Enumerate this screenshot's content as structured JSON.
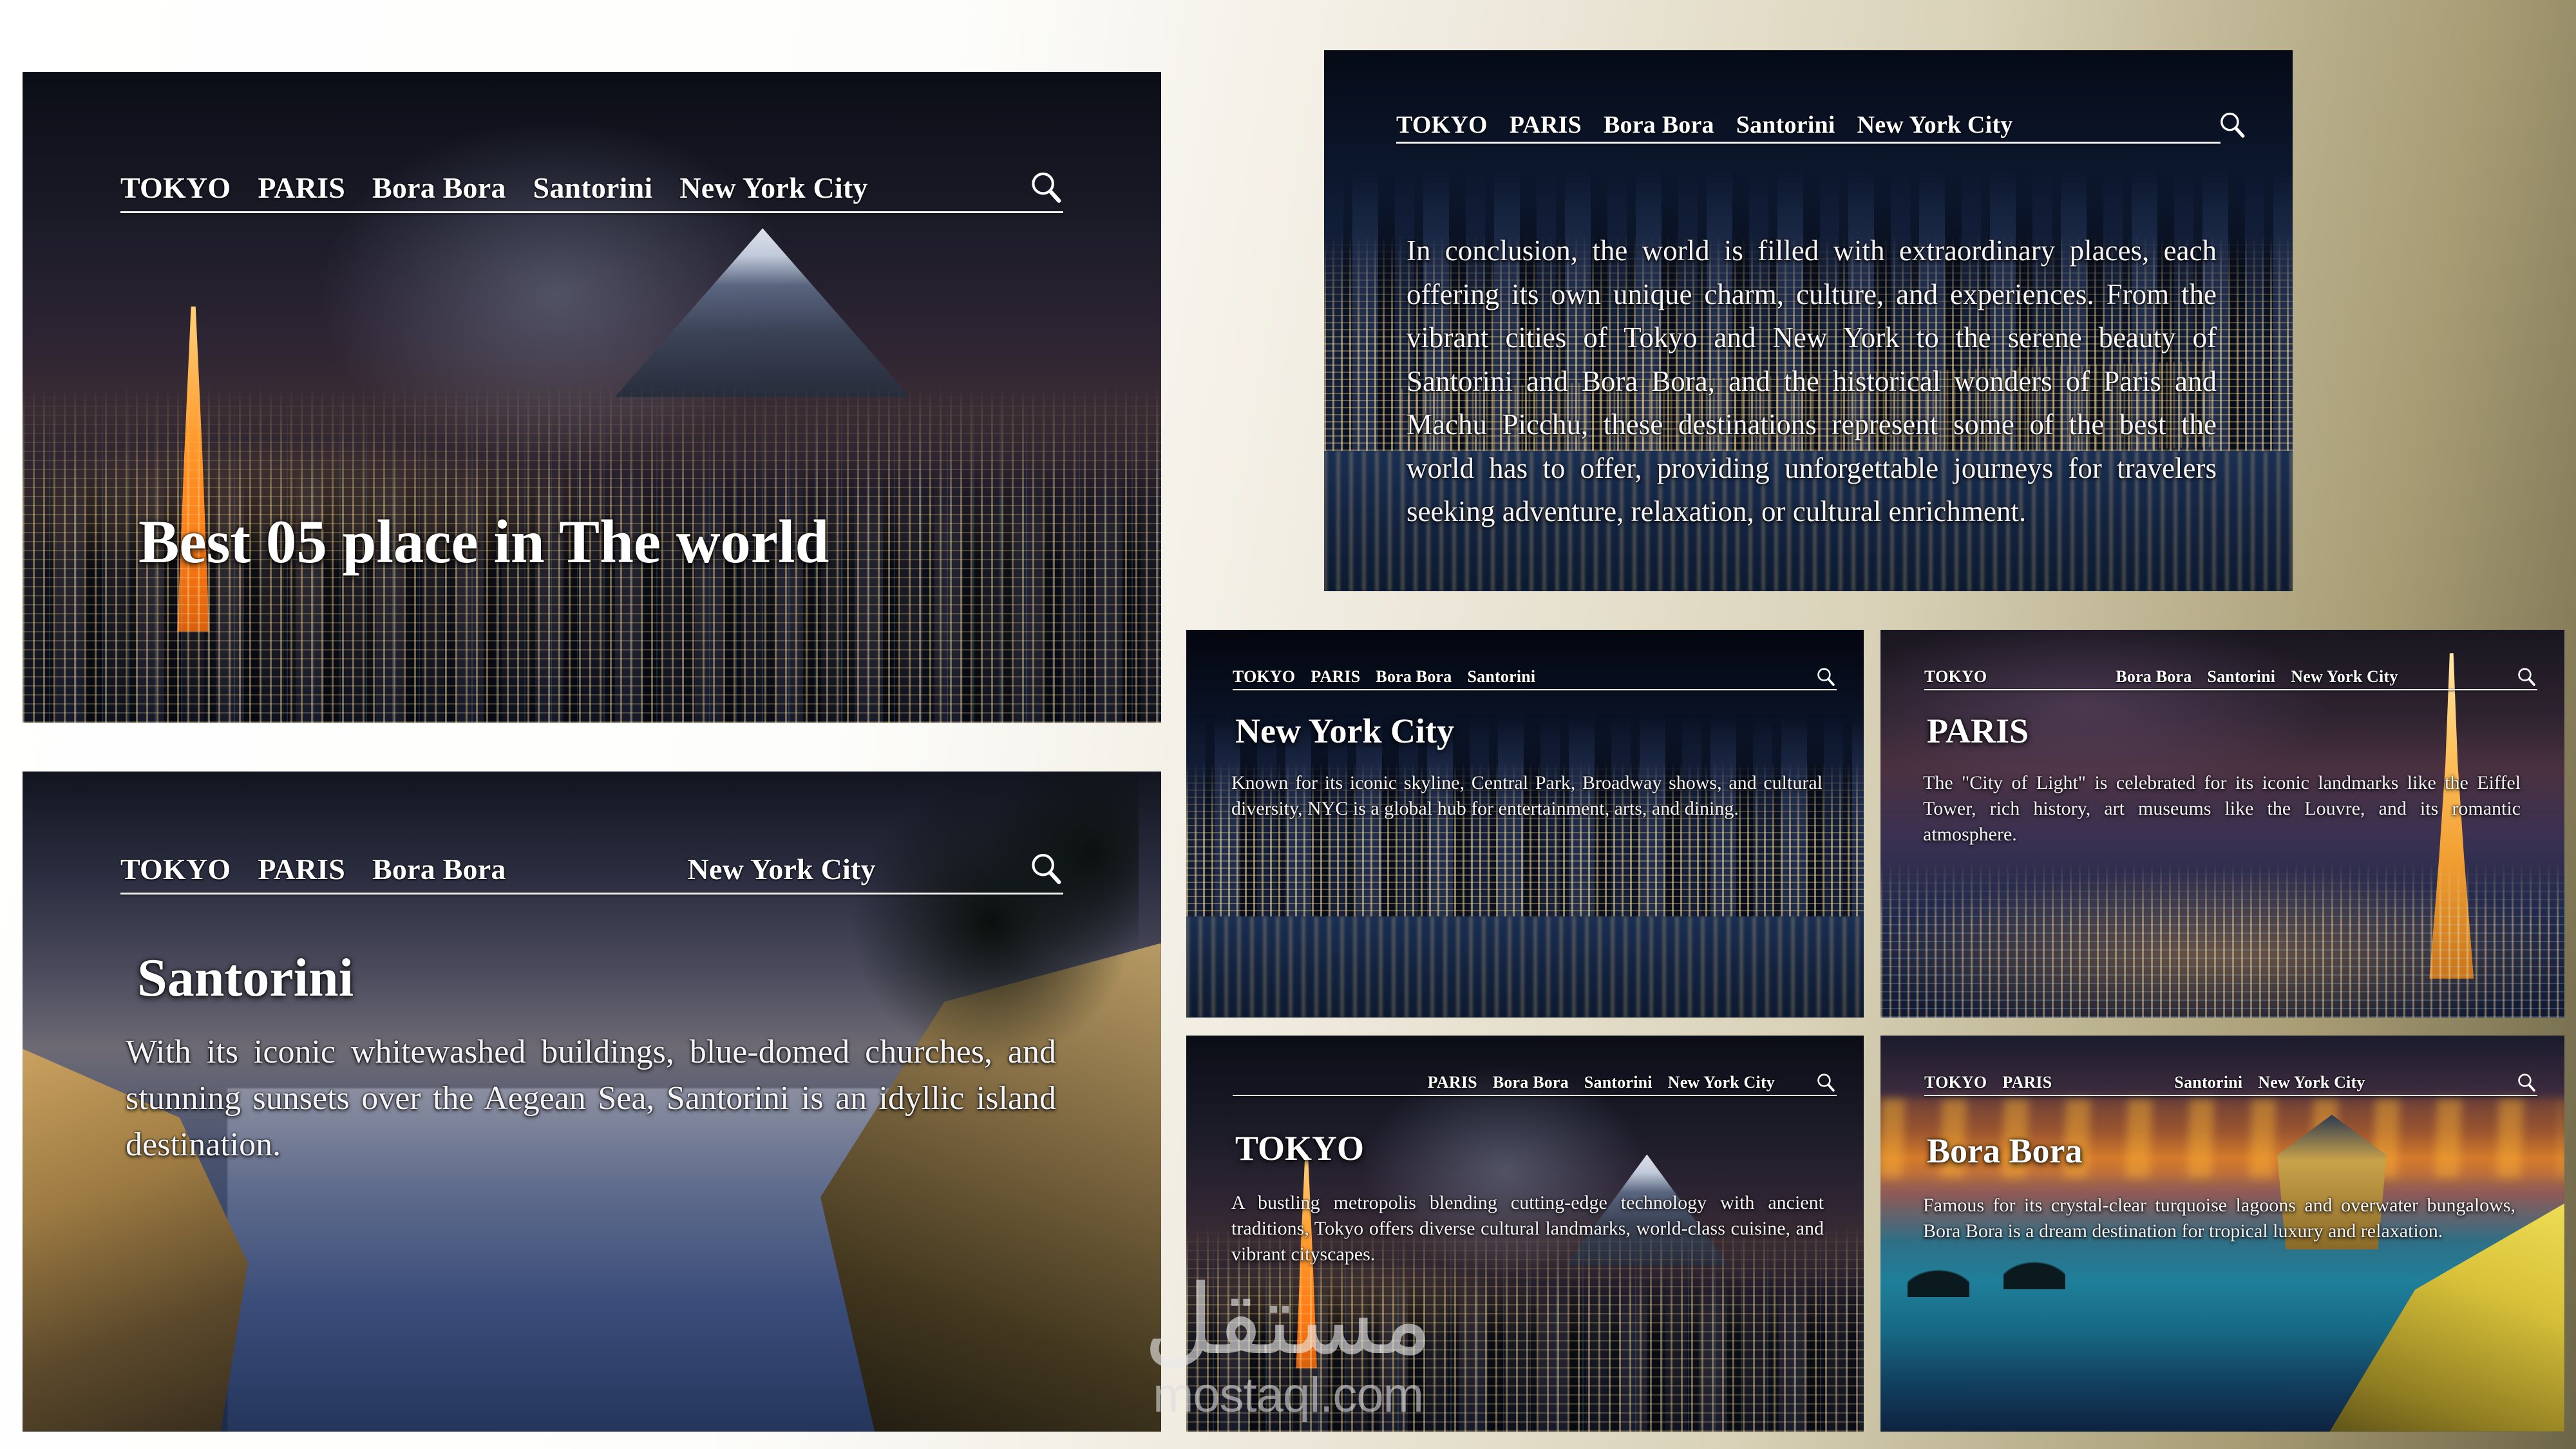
{
  "site": {
    "nav_items": [
      "TOKYO",
      "PARIS",
      "Bora Bora",
      "Santorini",
      "New York City"
    ],
    "search_icon": "search-icon"
  },
  "hero": {
    "title": "Best 05 place in The world",
    "nav": [
      "TOKYO",
      "PARIS",
      "Bora Bora",
      "Santorini",
      "New York City"
    ]
  },
  "conclusion": {
    "nav": [
      "TOKYO",
      "PARIS",
      "Bora Bora",
      "Santorini",
      "New York City"
    ],
    "text": "In conclusion, the world is filled with extraordinary places, each offering its own unique charm, culture, and experiences. From the vibrant cities of Tokyo and New York to the serene beauty of Santorini and Bora Bora, and the historical wonders of Paris and Machu Picchu, these destinations represent some of the best the world has to offer, providing unforgettable journeys for travelers seeking adventure, relaxation, or cultural enrichment."
  },
  "santorini": {
    "title": "Santorini",
    "nav": [
      "TOKYO",
      "PARIS",
      "Bora Bora",
      "",
      "New York City"
    ],
    "text": "With its iconic whitewashed buildings, blue-domed churches, and stunning sunsets over the Aegean Sea, Santorini is an idyllic island destination."
  },
  "cards": {
    "nyc": {
      "title": "New York City",
      "nav": [
        "TOKYO",
        "PARIS",
        "Bora Bora",
        "Santorini"
      ],
      "text": "Known for its iconic skyline, Central Park, Broadway shows, and cultural diversity, NYC is a global hub for entertainment, arts, and dining."
    },
    "paris": {
      "title": "PARIS",
      "nav": [
        "TOKYO",
        "",
        "Bora Bora",
        "Santorini",
        "New York City"
      ],
      "text": "The \"City of Light\" is celebrated for its iconic landmarks like the Eiffel Tower, rich history, art museums like the Louvre, and its romantic atmosphere."
    },
    "tokyo": {
      "title": "TOKYO",
      "nav": [
        "PARIS",
        "Bora Bora",
        "Santorini",
        "New York City"
      ],
      "text": "A bustling metropolis blending cutting-edge technology with ancient traditions, Tokyo offers diverse cultural landmarks, world-class cuisine, and vibrant cityscapes."
    },
    "bora": {
      "title": "Bora Bora",
      "nav": [
        "TOKYO",
        "PARIS",
        "",
        "Santorini",
        "New York City"
      ],
      "text": "Famous for its crystal-clear turquoise lagoons and overwater bungalows, Bora Bora is a dream destination for tropical luxury and relaxation."
    }
  },
  "watermark": {
    "arabic": "مستقل",
    "domain": "mostaql.com"
  },
  "colors": {
    "page_bg_light": "#ffffff",
    "page_bg_dark": "#6d6548",
    "nav_text": "#ffffff",
    "rule": "#f2f2f2"
  }
}
